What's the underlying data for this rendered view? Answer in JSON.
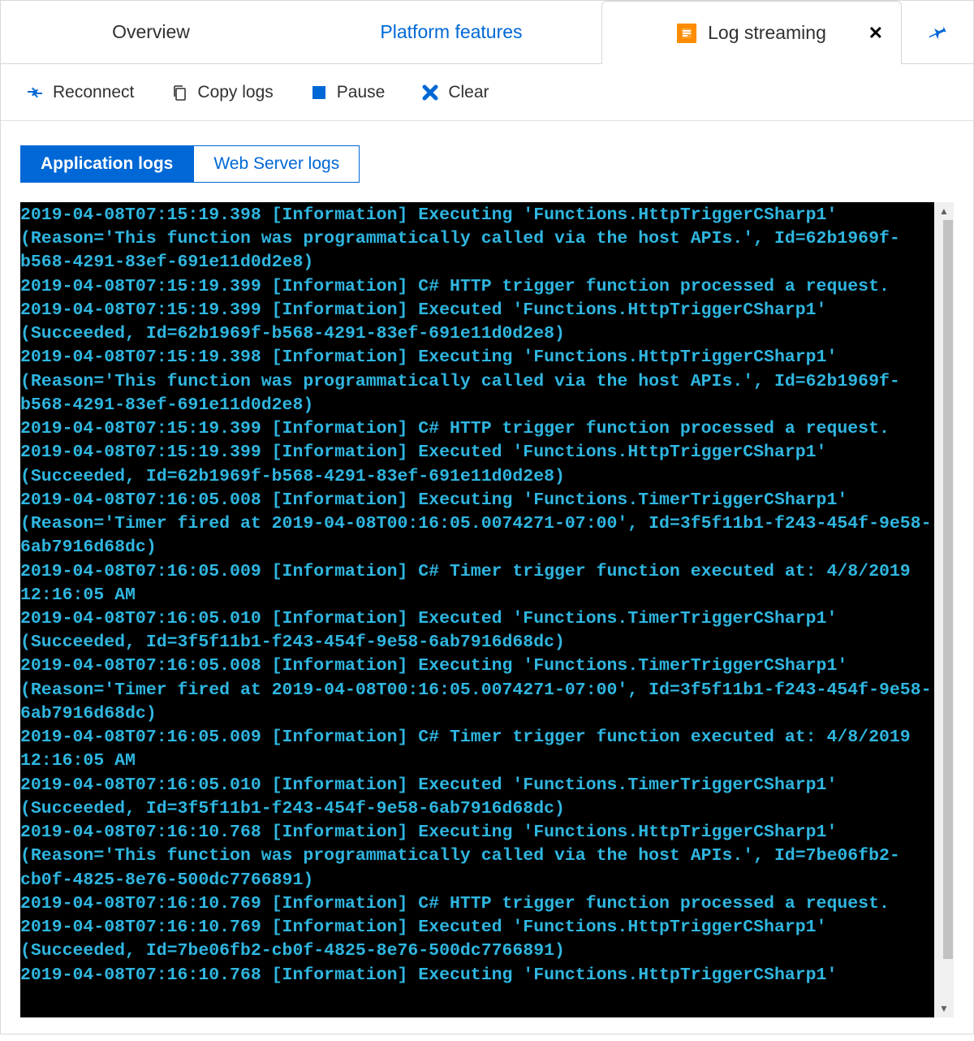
{
  "tabs": {
    "overview": "Overview",
    "platform": "Platform features",
    "log": "Log streaming"
  },
  "toolbar": {
    "reconnect": "Reconnect",
    "copy": "Copy logs",
    "pause": "Pause",
    "clear": "Clear"
  },
  "subtabs": {
    "app": "Application logs",
    "web": "Web Server logs"
  },
  "log_lines": [
    "2019-04-08T07:15:19.398 [Information] Executing 'Functions.HttpTriggerCSharp1' (Reason='This function was programmatically called via the host APIs.', Id=62b1969f-b568-4291-83ef-691e11d0d2e8)",
    "2019-04-08T07:15:19.399 [Information] C# HTTP trigger function processed a request.",
    "2019-04-08T07:15:19.399 [Information] Executed 'Functions.HttpTriggerCSharp1' (Succeeded, Id=62b1969f-b568-4291-83ef-691e11d0d2e8)",
    "2019-04-08T07:15:19.398 [Information] Executing 'Functions.HttpTriggerCSharp1' (Reason='This function was programmatically called via the host APIs.', Id=62b1969f-b568-4291-83ef-691e11d0d2e8)",
    "2019-04-08T07:15:19.399 [Information] C# HTTP trigger function processed a request.",
    "2019-04-08T07:15:19.399 [Information] Executed 'Functions.HttpTriggerCSharp1' (Succeeded, Id=62b1969f-b568-4291-83ef-691e11d0d2e8)",
    "2019-04-08T07:16:05.008 [Information] Executing 'Functions.TimerTriggerCSharp1' (Reason='Timer fired at 2019-04-08T00:16:05.0074271-07:00', Id=3f5f11b1-f243-454f-9e58-6ab7916d68dc)",
    "2019-04-08T07:16:05.009 [Information] C# Timer trigger function executed at: 4/8/2019 12:16:05 AM",
    "2019-04-08T07:16:05.010 [Information] Executed 'Functions.TimerTriggerCSharp1' (Succeeded, Id=3f5f11b1-f243-454f-9e58-6ab7916d68dc)",
    "2019-04-08T07:16:05.008 [Information] Executing 'Functions.TimerTriggerCSharp1' (Reason='Timer fired at 2019-04-08T00:16:05.0074271-07:00', Id=3f5f11b1-f243-454f-9e58-6ab7916d68dc)",
    "2019-04-08T07:16:05.009 [Information] C# Timer trigger function executed at: 4/8/2019 12:16:05 AM",
    "2019-04-08T07:16:05.010 [Information] Executed 'Functions.TimerTriggerCSharp1' (Succeeded, Id=3f5f11b1-f243-454f-9e58-6ab7916d68dc)",
    "2019-04-08T07:16:10.768 [Information] Executing 'Functions.HttpTriggerCSharp1' (Reason='This function was programmatically called via the host APIs.', Id=7be06fb2-cb0f-4825-8e76-500dc7766891)",
    "2019-04-08T07:16:10.769 [Information] C# HTTP trigger function processed a request.",
    "2019-04-08T07:16:10.769 [Information] Executed 'Functions.HttpTriggerCSharp1' (Succeeded, Id=7be06fb2-cb0f-4825-8e76-500dc7766891)",
    "2019-04-08T07:16:10.768 [Information] Executing 'Functions.HttpTriggerCSharp1'"
  ]
}
